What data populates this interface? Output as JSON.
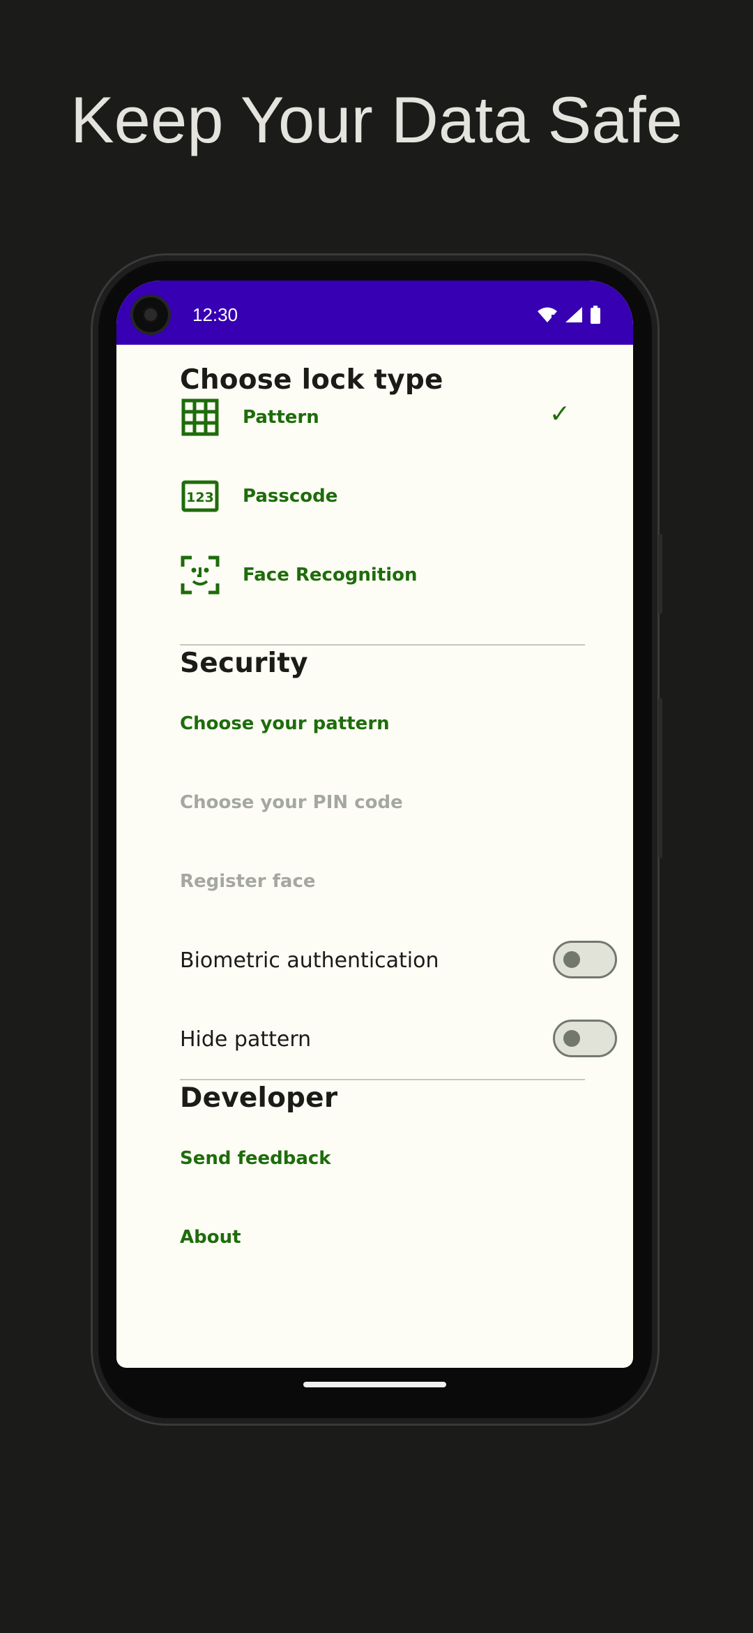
{
  "headline": "Keep Your Data Safe",
  "status_bar": {
    "time": "12:30",
    "color": "#3700b3"
  },
  "lock_type": {
    "title": "Choose lock type",
    "options": [
      {
        "label": "Pattern",
        "icon": "grid-icon",
        "selected": true
      },
      {
        "label": "Passcode",
        "icon": "passcode-123-icon",
        "selected": false
      },
      {
        "label": "Face Recognition",
        "icon": "face-scan-icon",
        "selected": false
      }
    ],
    "check_mark": "✓"
  },
  "security": {
    "title": "Security",
    "choose_pattern": "Choose your pattern",
    "choose_pin": "Choose your PIN code",
    "register_face": "Register face",
    "biometric": {
      "label": "Biometric authentication",
      "enabled": false
    },
    "hide_pattern": {
      "label": "Hide pattern",
      "enabled": false
    }
  },
  "developer": {
    "title": "Developer",
    "send_feedback": "Send feedback",
    "about": "About"
  },
  "colors": {
    "accent": "#1e6c0b",
    "background": "#fdfdf5",
    "page_background": "#1b1c19"
  }
}
